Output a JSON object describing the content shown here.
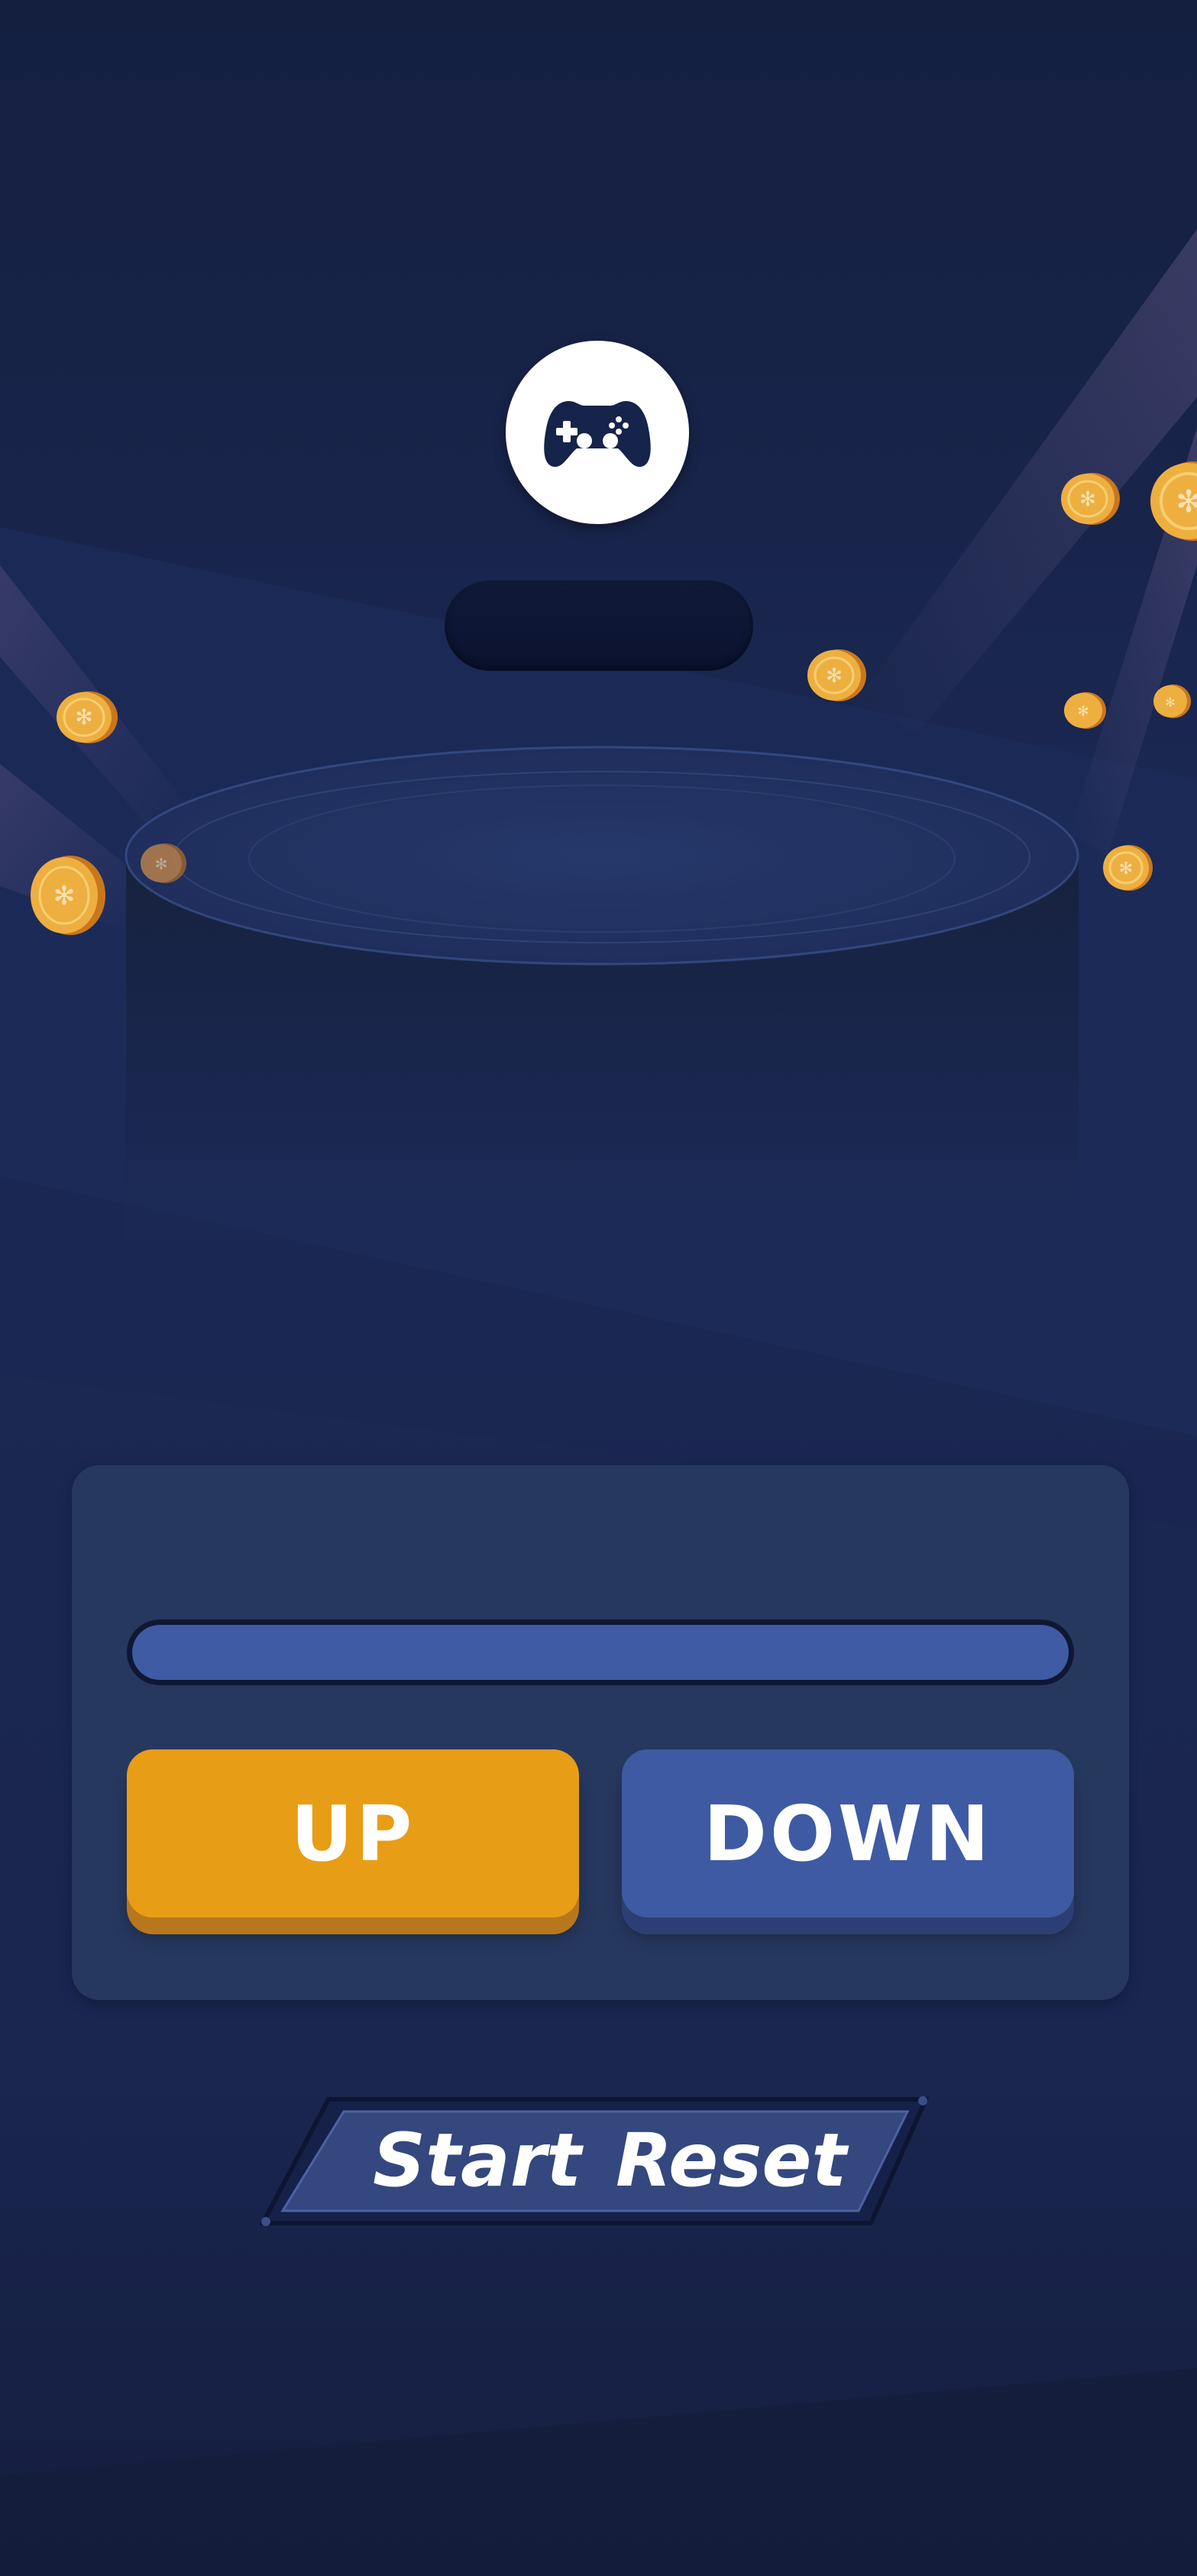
{
  "header": {
    "icon": "gamepad-icon",
    "score_text": ""
  },
  "panel": {
    "progress_fraction": 1.0,
    "up_label": "UP",
    "down_label": "DOWN"
  },
  "controls": {
    "start_label": "Start",
    "reset_label": "Reset"
  },
  "colors": {
    "background": "#18244a",
    "panel": "#27385f",
    "up_button": "#e89d17",
    "down_button": "#3e5aa3",
    "progress_fill": "#3e5ba4",
    "coin": "#e8a838"
  },
  "decor": {
    "coin_icon": "coin-icon"
  }
}
